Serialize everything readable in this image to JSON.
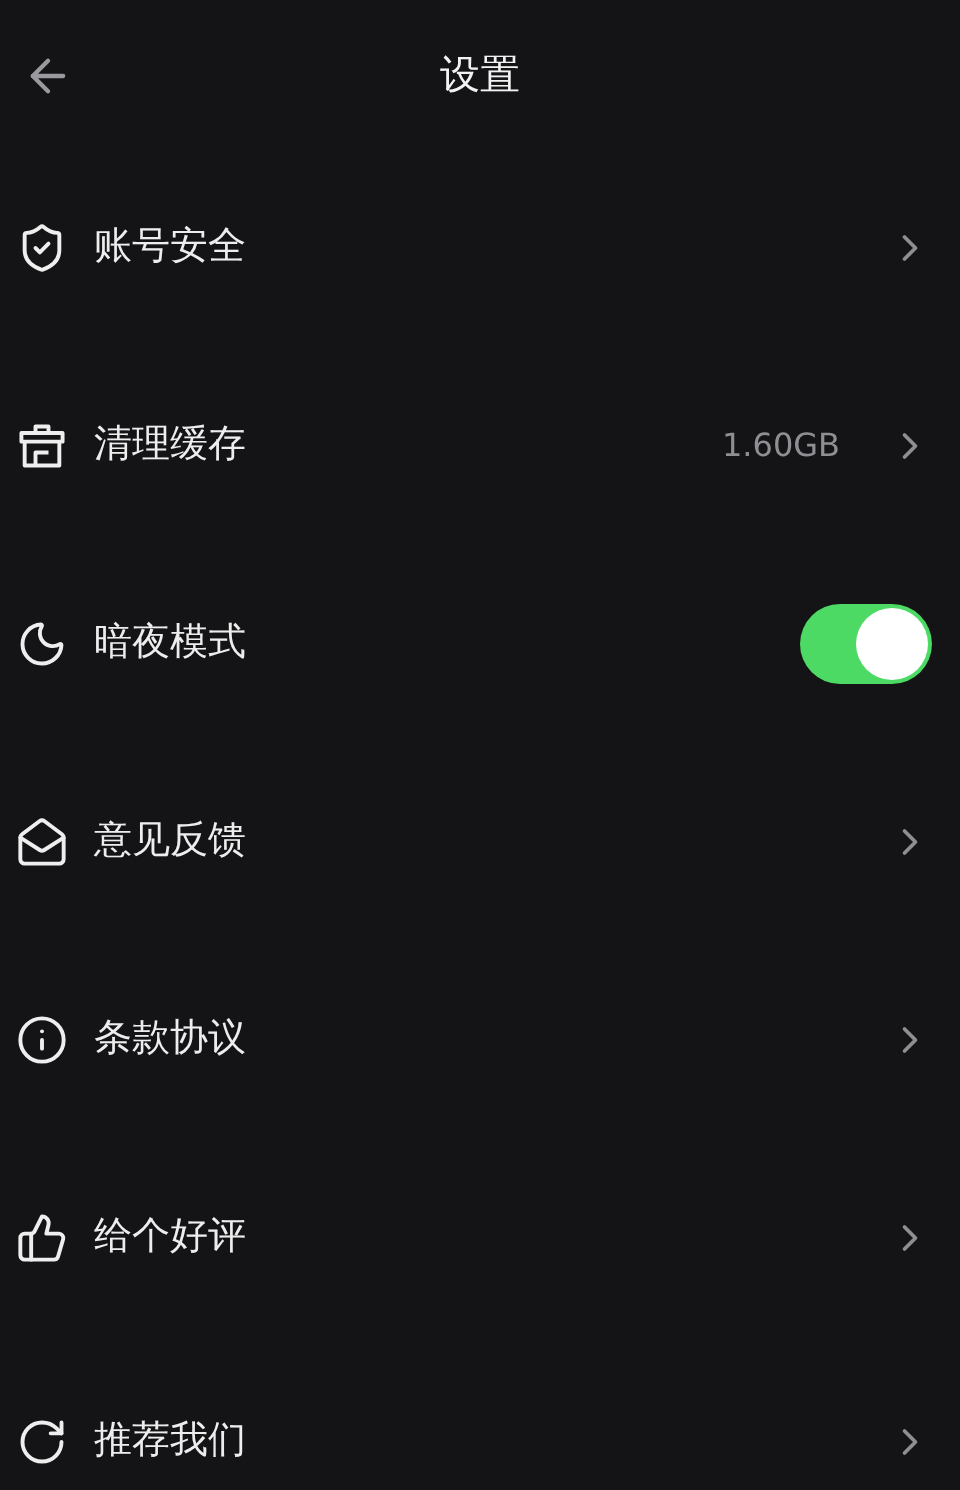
{
  "header": {
    "title": "设置"
  },
  "items": [
    {
      "kind": "link",
      "label": "账号安全"
    },
    {
      "kind": "link",
      "label": "清理缓存",
      "value": "1.60GB"
    },
    {
      "kind": "toggle",
      "label": "暗夜模式",
      "on": true
    },
    {
      "kind": "link",
      "label": "意见反馈"
    },
    {
      "kind": "link",
      "label": "条款协议"
    },
    {
      "kind": "link",
      "label": "给个好评"
    },
    {
      "kind": "link",
      "label": "推荐我们"
    }
  ]
}
